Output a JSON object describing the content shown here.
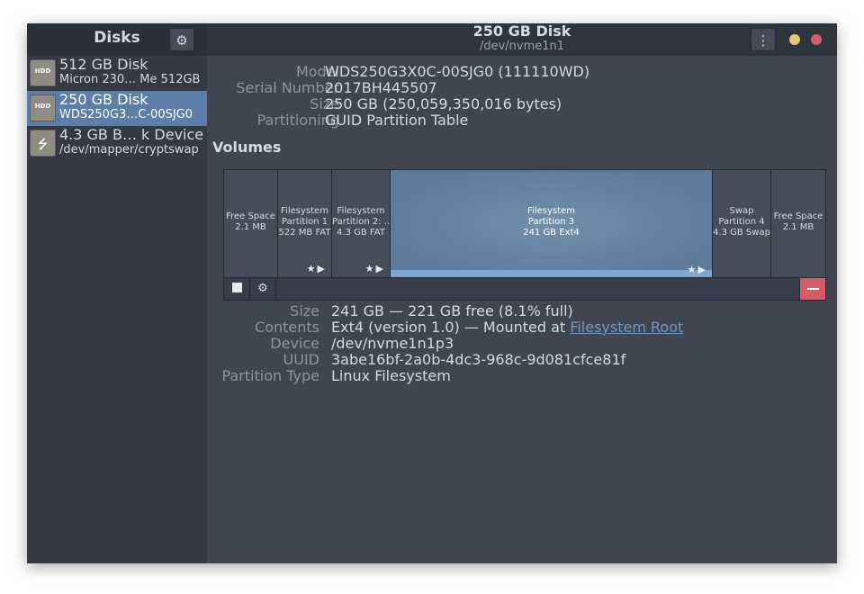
{
  "sidebar": {
    "title": "Disks",
    "gear_icon": "gear-icon",
    "items": [
      {
        "name": "512 GB Disk",
        "sub": "Micron 230… Me 512GB",
        "icon": "HDD",
        "selected": false
      },
      {
        "name": "250 GB Disk",
        "sub": "WDS250G3…C-00SJG0",
        "icon": "HDD",
        "selected": true
      },
      {
        "name": "4.3 GB B… k Device",
        "sub": "/dev/mapper/cryptswap",
        "icon": "usb-icon",
        "usb_glyph": "⭍",
        "selected": false
      }
    ]
  },
  "header": {
    "title": "250 GB Disk",
    "subtitle": "/dev/nvme1n1",
    "menu_icon": "⋮",
    "gear_glyph": "⚙"
  },
  "disk_info": {
    "model_label": "Model",
    "model": "WDS250G3X0C-00SJG0 (111110WD)",
    "serial_label": "Serial Number",
    "serial": "2017BH445507",
    "size_label": "Size",
    "size": "250 GB (250,059,350,016 bytes)",
    "partitioning_label": "Partitioning",
    "partitioning": "GUID Partition Table"
  },
  "volumes": {
    "title": "Volumes",
    "segments": [
      {
        "line1": "Free Space",
        "line2": "2.1 MB",
        "line3": "",
        "marks": "",
        "selected": false
      },
      {
        "line1": "Filesystem",
        "line2": "Partition 1",
        "line3": "522 MB FAT",
        "marks": "★▶",
        "selected": false
      },
      {
        "line1": "Filesystem",
        "line2": "Partition 2: …",
        "line3": "4.3 GB FAT",
        "marks": "★▶",
        "selected": false
      },
      {
        "line1": "Filesystem",
        "line2": "Partition 3",
        "line3": "241 GB Ext4",
        "marks": "★▶",
        "selected": true
      },
      {
        "line1": "Swap",
        "line2": "Partition 4",
        "line3": "4.3 GB Swap",
        "marks": "",
        "selected": false
      },
      {
        "line1": "Free Space",
        "line2": "2.1 MB",
        "line3": "",
        "marks": "",
        "selected": false
      }
    ],
    "toolbar": {
      "settings_glyph": "⚙"
    }
  },
  "partition_info": {
    "size_label": "Size",
    "size": "241 GB — 221 GB free (8.1% full)",
    "contents_label": "Contents",
    "contents_prefix": "Ext4 (version 1.0) — Mounted at ",
    "contents_link": "Filesystem Root",
    "device_label": "Device",
    "device": "/dev/nvme1n1p3",
    "uuid_label": "UUID",
    "uuid": "3abe16bf-2a0b-4dc3-968c-9d081cfce81f",
    "type_label": "Partition Type",
    "type": "Linux Filesystem"
  },
  "colors": {
    "accent": "#5c7ea8",
    "delete": "#d35d68",
    "link": "#7295c0"
  }
}
